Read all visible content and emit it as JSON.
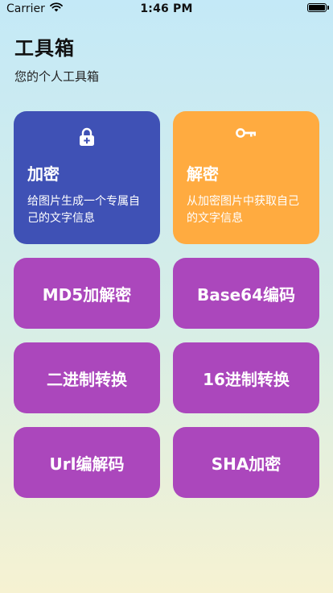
{
  "status_bar": {
    "carrier": "Carrier",
    "time": "1:46 PM"
  },
  "header": {
    "title": "工具箱",
    "subtitle": "您的个人工具箱"
  },
  "cards": {
    "encrypt": {
      "title": "加密",
      "description": "给图片生成一个专属自己的文字信息",
      "icon": "lock-icon",
      "color": "#3f51b5"
    },
    "decrypt": {
      "title": "解密",
      "description": "从加密图片中获取自己的文字信息",
      "icon": "key-icon",
      "color": "#ffab40"
    },
    "tools": [
      {
        "label": "MD5加解密"
      },
      {
        "label": "Base64编码"
      },
      {
        "label": "二进制转换"
      },
      {
        "label": "16进制转换"
      },
      {
        "label": "Url编解码"
      },
      {
        "label": "SHA加密"
      }
    ],
    "tool_color": "#ab47bc"
  }
}
